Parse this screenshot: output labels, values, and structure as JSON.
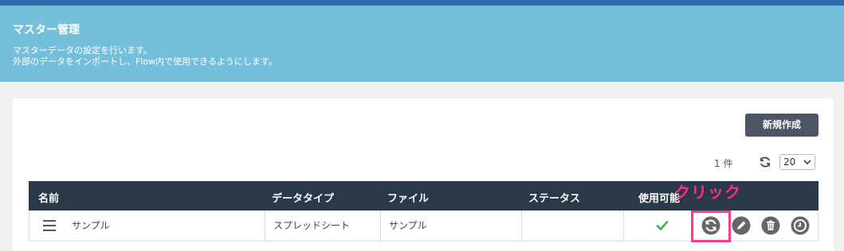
{
  "header": {
    "title": "マスター管理",
    "desc_line1": "マスターデータの設定を行います。",
    "desc_line2": "外部のデータをインポートし、Flow内で使用できるようにします。"
  },
  "toolbar": {
    "new_button": "新規作成",
    "count": "1 件",
    "per_page": "20"
  },
  "table": {
    "columns": [
      "名前",
      "データタイプ",
      "ファイル",
      "ステータス",
      "使用可能"
    ],
    "rows": [
      {
        "name": "サンプル",
        "data_type": "スプレッドシート",
        "file": "サンプル",
        "status": "",
        "usable": true
      }
    ]
  },
  "annotation": {
    "label": "クリック",
    "color": "#ff2f86"
  },
  "colors": {
    "topbar": "#2f6aa8",
    "header_bg": "#76bfdb",
    "table_header_bg": "#2b3848",
    "button_bg": "#4c5566",
    "check_color": "#4cae4c",
    "action_icon_color": "#666666"
  },
  "icons": [
    "menu-icon",
    "refresh-icon",
    "chevron-down-icon",
    "check-icon",
    "sync-icon",
    "pencil-icon",
    "trash-icon",
    "clock-icon"
  ]
}
